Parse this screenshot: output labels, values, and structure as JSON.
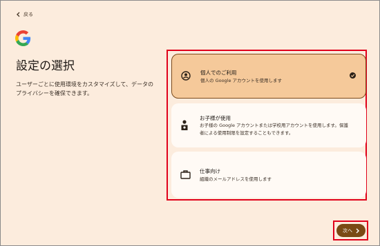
{
  "back": {
    "label": "戻る"
  },
  "header": {
    "title": "設定の選択",
    "description": "ユーザーごとに使用環境をカスタマイズして、データのプライバシーを確保できます。"
  },
  "options": [
    {
      "title": "個人でのご利用",
      "subtitle": "個人の Google アカウントを使用します",
      "icon": "person-icon",
      "selected": true
    },
    {
      "title": "お子様が使用",
      "subtitle": "お子様の Google アカウントまたは学校用アカウントを使用します。保護者による使用制限を設定することもできます。",
      "icon": "child-icon",
      "selected": false
    },
    {
      "title": "仕事向け",
      "subtitle": "組織のメールアドレスを使用します",
      "icon": "briefcase-icon",
      "selected": false
    }
  ],
  "next": {
    "label": "次へ"
  },
  "colors": {
    "background": "#fcecdd",
    "selected_card": "#f5c99a",
    "accent": "#7a4a14",
    "highlight": "#e0001a"
  }
}
